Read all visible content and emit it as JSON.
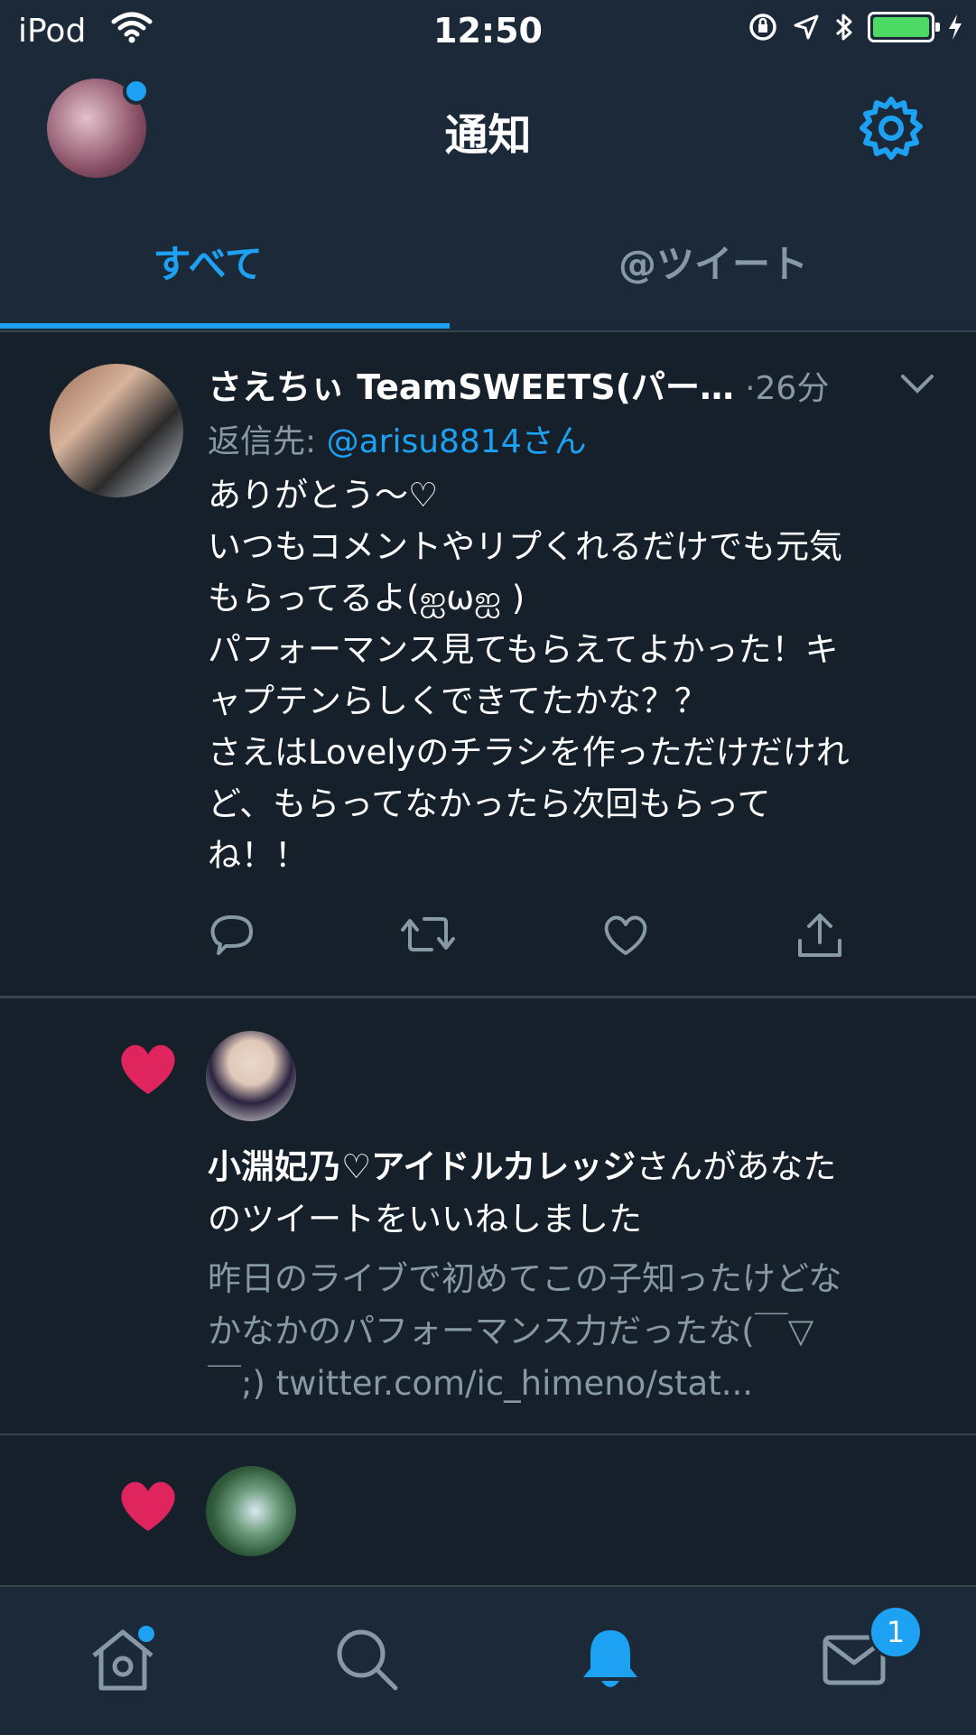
{
  "status_bar": {
    "carrier": "iPod",
    "time": "12:50"
  },
  "header": {
    "title": "通知"
  },
  "tabs": [
    {
      "label": "すべて",
      "active": true
    },
    {
      "label": "@ツイート",
      "active": false
    }
  ],
  "tweet": {
    "name": "さえちぃ TeamSWEETS(パー…",
    "time": "26分",
    "reply_prefix": "返信先: ",
    "reply_handle": "@arisu8814さん",
    "body_lines": [
      "ありがとう〜♡",
      "いつもコメントやリプくれるだけでも元気",
      "もらってるよ(ஐωஐ )",
      "パフォーマンス見てもらえてよかった！キ",
      "ャプテンらしくできてたかな？？",
      "さえはLovelyのチラシを作っただけだけれ",
      "ど、もらってなかったら次回もらって",
      "ね！！"
    ]
  },
  "notification1": {
    "user_name": "小淵妃乃♡アイドルカレッジ",
    "action_line1": "さんがあなた",
    "action_line2": "のツイートをいいねしました",
    "excerpt_lines": [
      "昨日のライブで初めてこの子知ったけどな",
      "かなかのパフォーマンス力だったな(￣▽",
      "￣;) twitter.com/ic_himeno/stat..."
    ]
  },
  "bottom_nav": {
    "messages_badge": "1"
  },
  "colors": {
    "background": "#15202b",
    "bar": "#1c2938",
    "accent": "#1da1f2",
    "like": "#e0245e",
    "secondary_text": "#8899a6"
  }
}
